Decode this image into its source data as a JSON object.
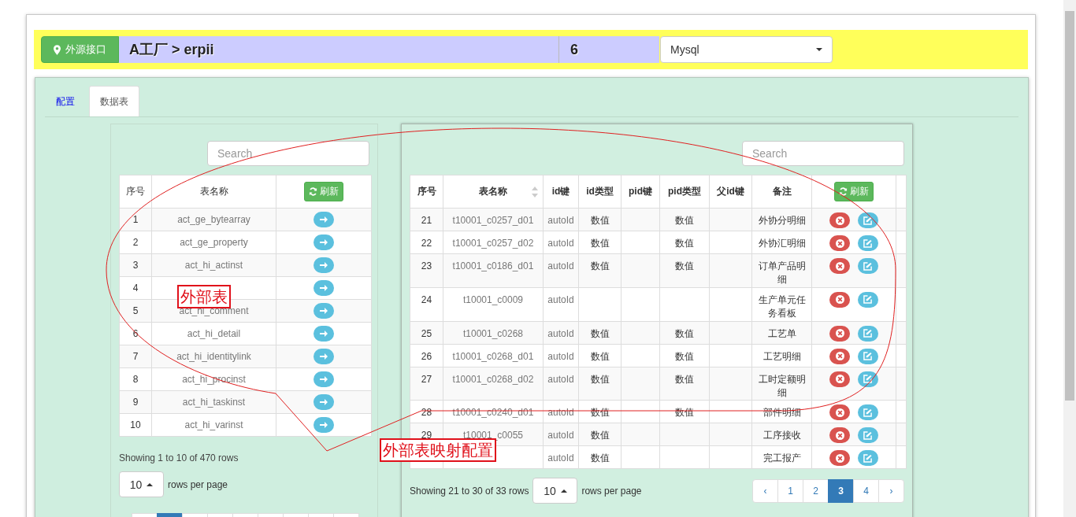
{
  "header": {
    "badge": "外源接口",
    "path": "A工厂 > erpii",
    "count": "6",
    "select": "Mysql"
  },
  "tabs": [
    {
      "label": "配置",
      "selected": false
    },
    {
      "label": "数据表",
      "selected": true
    }
  ],
  "source_tables": {
    "search_placeholder": "Search",
    "columns": [
      "序号",
      "表名称"
    ],
    "refresh": "刷新",
    "rows": [
      {
        "no": "1",
        "name": "act_ge_bytearray"
      },
      {
        "no": "2",
        "name": "act_ge_property"
      },
      {
        "no": "3",
        "name": "act_hi_actinst"
      },
      {
        "no": "4"
      },
      {
        "no": "5",
        "name": "act_hi_comment"
      },
      {
        "no": "6",
        "name": "act_hi_detail"
      },
      {
        "no": "7",
        "name": "act_hi_identitylink"
      },
      {
        "no": "8",
        "name": "act_hi_procinst"
      },
      {
        "no": "9",
        "name": "act_hi_taskinst"
      },
      {
        "no": "10",
        "name": "act_hi_varinst"
      }
    ],
    "summary": "Showing 1 to 10 of 470 rows",
    "page_size": "10",
    "page_size_suffix": "rows per page",
    "pages": [
      {
        "selected": false
      },
      {
        "selected": true
      },
      {
        "selected": false
      },
      {
        "selected": false
      },
      {
        "selected": false
      },
      {
        "selected": false
      },
      {
        "selected": false
      },
      {
        "selected": false
      },
      {
        "selected": false
      }
    ]
  },
  "mapped_tables": {
    "search_placeholder": "Search",
    "columns": [
      "序号",
      "表名称",
      "id键",
      "id类型",
      "pid键",
      "pid类型",
      "父id键",
      "备注"
    ],
    "refresh": "刷新",
    "rows": [
      {
        "no": "21",
        "name": "t10001_c0257_d01",
        "id_key": "autoId",
        "id_type": "数值",
        "pid_type": "数值",
        "remark": "外协分明细"
      },
      {
        "no": "22",
        "name": "t10001_c0257_d02",
        "id_key": "autoId",
        "id_type": "数值",
        "pid_type": "数值",
        "remark": "外协汇明细"
      },
      {
        "no": "23",
        "name": "t10001_c0186_d01",
        "id_key": "autoId",
        "id_type": "数值",
        "pid_type": "数值",
        "remark": "订单产品明细"
      },
      {
        "no": "24",
        "name": "t10001_c0009",
        "id_key": "autoId",
        "remark": "生产单元任务看板"
      },
      {
        "no": "25",
        "name": "t10001_c0268",
        "id_key": "autoId",
        "id_type": "数值",
        "pid_type": "数值",
        "remark": "工艺单"
      },
      {
        "no": "26",
        "name": "t10001_c0268_d01",
        "id_key": "autoId",
        "id_type": "数值",
        "pid_type": "数值",
        "remark": "工艺明细"
      },
      {
        "no": "27",
        "name": "t10001_c0268_d02",
        "id_key": "autoId",
        "id_type": "数值",
        "pid_type": "数值",
        "remark": "工时定额明细"
      },
      {
        "no": "28",
        "name": "t10001_c0240_d01",
        "id_key": "autoId",
        "id_type": "数值",
        "pid_type": "数值",
        "remark": "部件明细"
      },
      {
        "no": "29",
        "name": "t10001_c0055",
        "id_key": "autoId",
        "id_type": "数值",
        "remark": "工序接收"
      },
      {
        "id_key": "autoId",
        "id_type": "数值",
        "remark": "完工报产"
      }
    ],
    "summary": "Showing 21 to 30 of 33 rows",
    "page_size": "10",
    "page_size_suffix": "rows per page",
    "pages": [
      {
        "label": "‹",
        "selected": false
      },
      {
        "label": "1",
        "selected": false
      },
      {
        "label": "2",
        "selected": false
      },
      {
        "label": "3",
        "selected": true
      },
      {
        "label": "4",
        "selected": false
      },
      {
        "label": "›",
        "selected": false
      }
    ]
  },
  "annotations": [
    {
      "text": "外部表"
    },
    {
      "text": "外部表映射配置"
    }
  ]
}
